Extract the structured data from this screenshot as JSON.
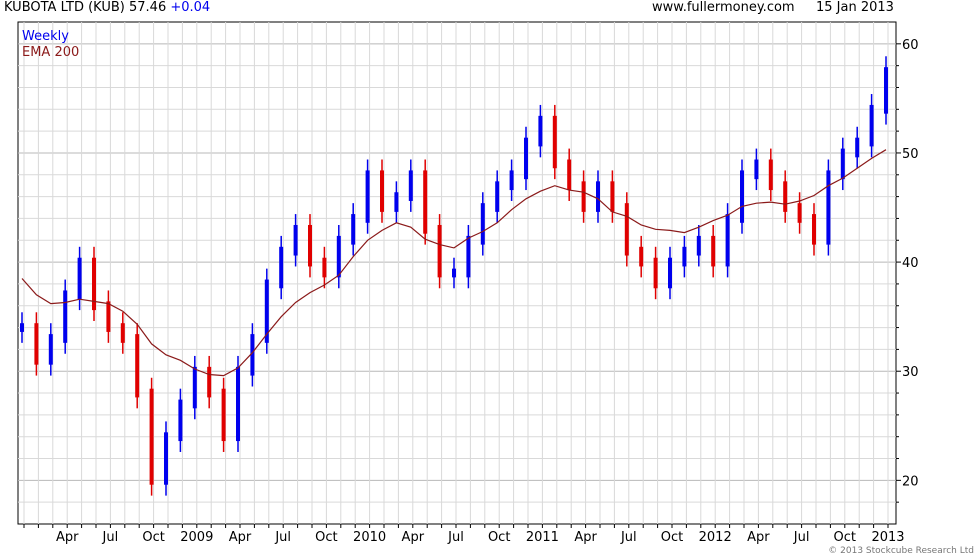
{
  "header": {
    "symbol": "KUBOTA LTD (KUB)",
    "price": "57.46",
    "change": "+0.04",
    "site": "www.fullermoney.com",
    "date": "15 Jan 2013"
  },
  "legend": {
    "weekly": "Weekly",
    "ema": "EMA 200"
  },
  "copyright": "© 2013 Stockcube Research Ltd",
  "colors": {
    "up": "#0000ee",
    "down": "#e00000",
    "ema": "#8b1a1a",
    "grid": "#d9d9d9",
    "axis": "#000000"
  },
  "chart_data": {
    "type": "line",
    "title": "KUBOTA LTD (KUB)",
    "frequency": "Weekly",
    "x": [
      "2008-01",
      "2008-02",
      "2008-03",
      "2008-04",
      "2008-05",
      "2008-06",
      "2008-07",
      "2008-08",
      "2008-09",
      "2008-10",
      "2008-11",
      "2008-12",
      "2009-01",
      "2009-02",
      "2009-03",
      "2009-04",
      "2009-05",
      "2009-06",
      "2009-07",
      "2009-08",
      "2009-09",
      "2009-10",
      "2009-11",
      "2009-12",
      "2010-01",
      "2010-02",
      "2010-03",
      "2010-04",
      "2010-05",
      "2010-06",
      "2010-07",
      "2010-08",
      "2010-09",
      "2010-10",
      "2010-11",
      "2010-12",
      "2011-01",
      "2011-02",
      "2011-03",
      "2011-04",
      "2011-05",
      "2011-06",
      "2011-07",
      "2011-08",
      "2011-09",
      "2011-10",
      "2011-11",
      "2011-12",
      "2012-01",
      "2012-02",
      "2012-03",
      "2012-04",
      "2012-05",
      "2012-06",
      "2012-07",
      "2012-08",
      "2012-09",
      "2012-10",
      "2012-11",
      "2012-12",
      "2013-01"
    ],
    "series": [
      {
        "name": "Weekly",
        "values": [
          34,
          31,
          33,
          37,
          40,
          36,
          34,
          33,
          28,
          20,
          24,
          27,
          30,
          28,
          24,
          30,
          33,
          38,
          41,
          43,
          40,
          39,
          42,
          44,
          48,
          45,
          46,
          48,
          43,
          39,
          39,
          42,
          45,
          47,
          48,
          51,
          53,
          49,
          47,
          45,
          47,
          45,
          41,
          40,
          38,
          40,
          41,
          42,
          40,
          44,
          48,
          49,
          47,
          45,
          44,
          42,
          48,
          50,
          51,
          54,
          57.46
        ]
      },
      {
        "name": "EMA 200",
        "values": [
          38.5,
          37,
          36.2,
          36.3,
          36.6,
          36.4,
          36.2,
          35.5,
          34.3,
          32.5,
          31.5,
          31,
          30.2,
          29.7,
          29.6,
          30.3,
          31.7,
          33.4,
          35,
          36.3,
          37.2,
          37.9,
          38.8,
          40.5,
          42,
          42.9,
          43.6,
          43.2,
          42.1,
          41.6,
          41.3,
          42.2,
          42.8,
          43.6,
          44.8,
          45.8,
          46.5,
          47,
          46.6,
          46.4,
          45.8,
          44.6,
          44.2,
          43.4,
          43,
          42.9,
          42.7,
          43.2,
          43.8,
          44.3,
          45.1,
          45.4,
          45.5,
          45.3,
          45.6,
          46.1,
          47,
          47.7,
          48.6,
          49.5,
          50.3
        ]
      }
    ],
    "xticks": [
      "Apr",
      "Jul",
      "Oct",
      "2009",
      "Apr",
      "Jul",
      "Oct",
      "2010",
      "Apr",
      "Jul",
      "Oct",
      "2011",
      "Apr",
      "Jul",
      "Oct",
      "2012",
      "Apr",
      "Jul",
      "Oct",
      "2013"
    ],
    "yticks": [
      20,
      30,
      40,
      50,
      60
    ],
    "ylim": [
      16,
      62
    ],
    "xlabel": "",
    "ylabel": "",
    "grid": true,
    "legend_position": "top-left"
  }
}
